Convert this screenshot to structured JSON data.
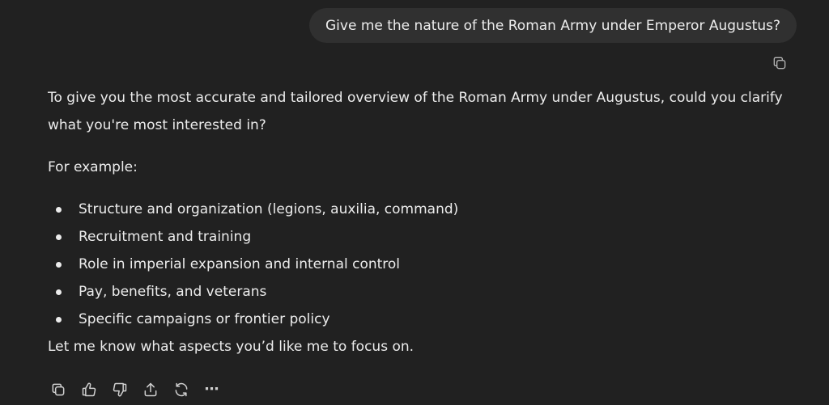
{
  "user_message": {
    "text": "Give me the nature of the Roman Army under Emperor Augustus?"
  },
  "assistant_message": {
    "intro": "To give you the most accurate and tailored overview of the Roman Army under Augustus, could you clarify what you're most interested in?",
    "example_label": "For example:",
    "bullets": [
      "Structure and organization (legions, auxilia, command)",
      "Recruitment and training",
      "Role in imperial expansion and internal control",
      "Pay, benefits, and veterans",
      "Specific campaigns or frontier policy"
    ],
    "closing": "Let me know what aspects you’d like me to focus on."
  },
  "actions": {
    "icons": [
      "copy-icon",
      "thumbs-up-icon",
      "thumbs-down-icon",
      "share-icon",
      "regenerate-icon",
      "more-icon"
    ],
    "more_label": "⋯"
  },
  "colors": {
    "background": "#212121",
    "user_bubble": "#303030",
    "text": "#ececec"
  }
}
